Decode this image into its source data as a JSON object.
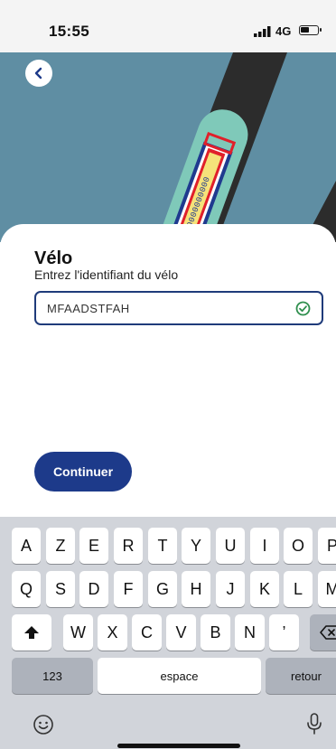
{
  "status_bar": {
    "time": "15:55",
    "network": "4G"
  },
  "header": {
    "back_icon": "chevron-left-icon"
  },
  "form": {
    "title": "Vélo",
    "subtitle": "Entrez l'identifiant du vélo",
    "bike_id_value": "MFAADSTFAH",
    "valid_icon": "check-circle-icon",
    "continue_label": "Continuer"
  },
  "colors": {
    "primary": "#1d3a8a",
    "hero_bg": "#5f8ea3",
    "bike_teal": "#7fc9b9",
    "valid_green": "#2f8f4e"
  },
  "keyboard": {
    "row1": [
      "A",
      "Z",
      "E",
      "R",
      "T",
      "Y",
      "U",
      "I",
      "O",
      "P"
    ],
    "row2": [
      "Q",
      "S",
      "D",
      "F",
      "G",
      "H",
      "J",
      "K",
      "L",
      "M"
    ],
    "row3": [
      "W",
      "X",
      "C",
      "V",
      "B",
      "N",
      "’"
    ],
    "numbers_label": "123",
    "space_label": "espace",
    "return_label": "retour",
    "shift_icon": "shift-icon",
    "delete_icon": "backspace-icon",
    "emoji_icon": "emoji-icon",
    "mic_icon": "microphone-icon"
  }
}
